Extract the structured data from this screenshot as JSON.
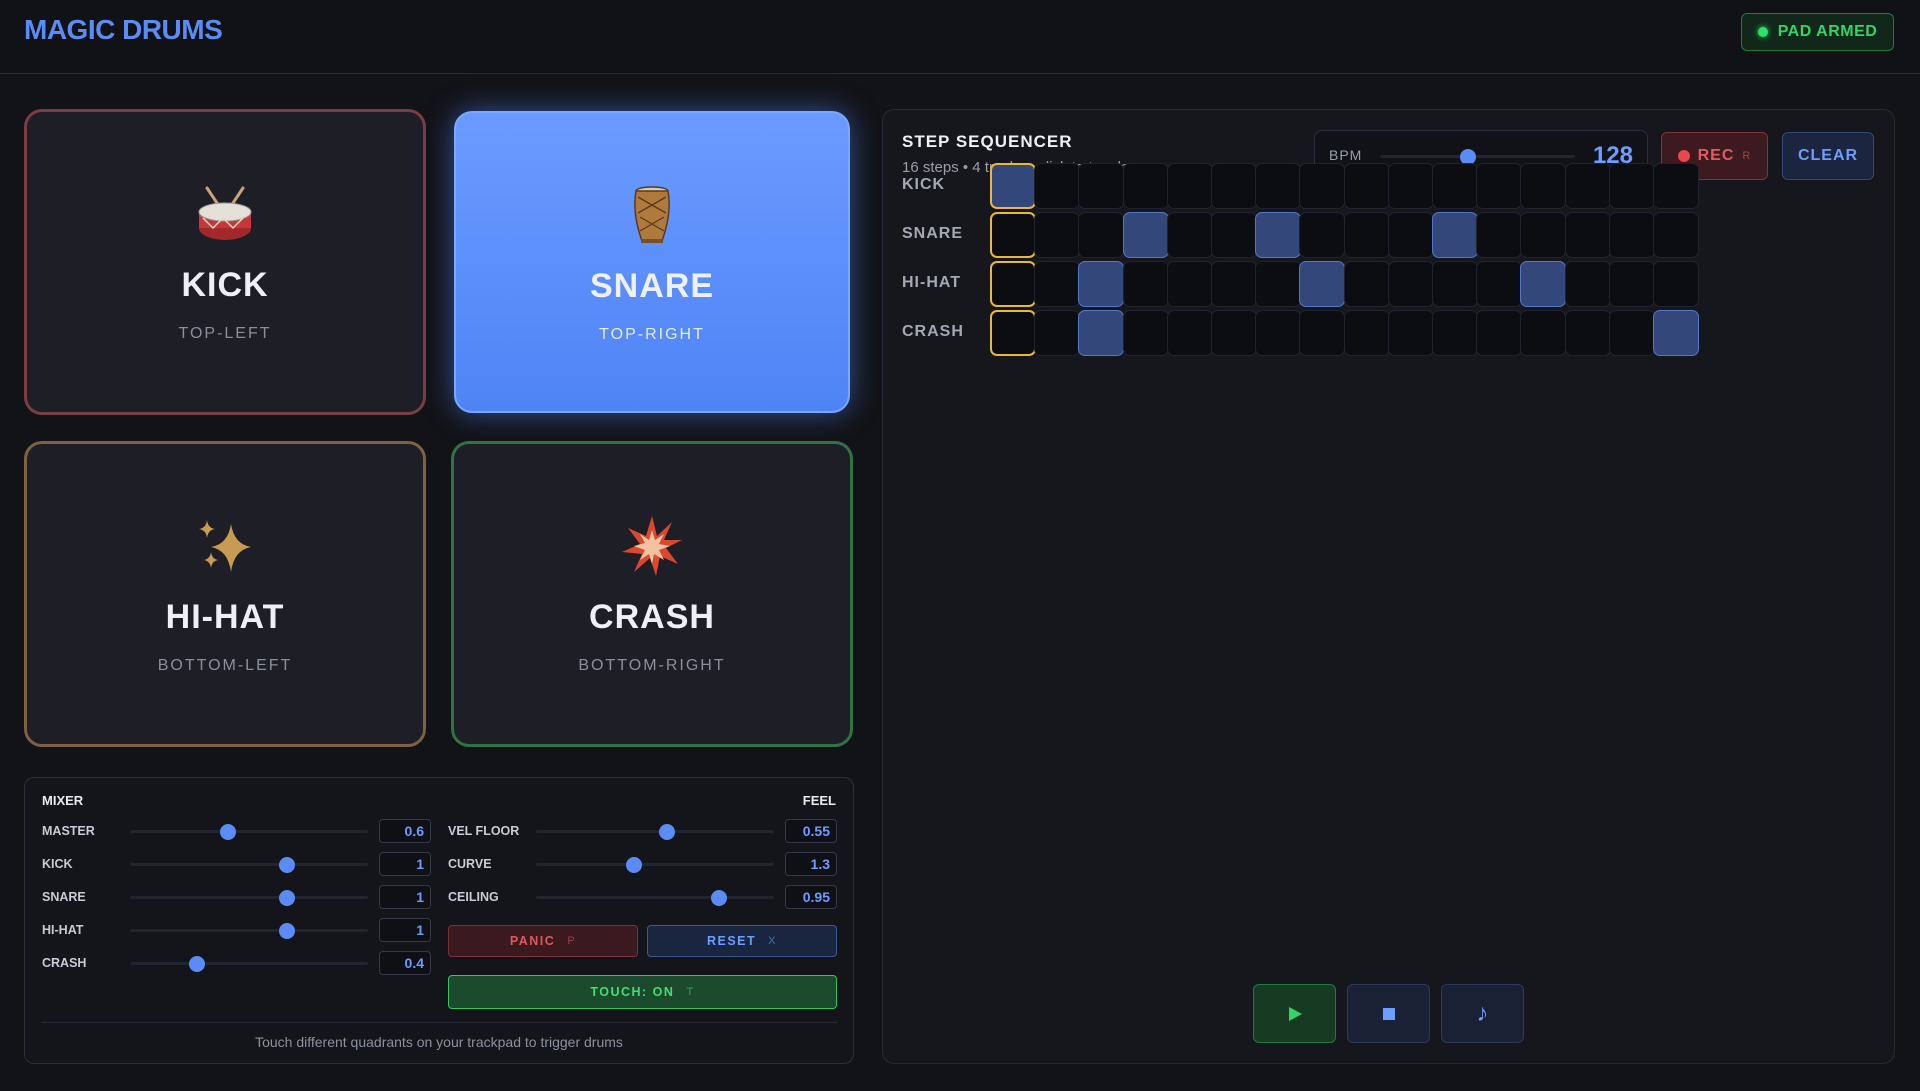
{
  "app": {
    "title": "MAGIC DRUMS",
    "status": "PAD ARMED",
    "status_color": "#2ee06a"
  },
  "pads": [
    {
      "name": "KICK",
      "position": "TOP-LEFT",
      "icon": "drum-icon"
    },
    {
      "name": "SNARE",
      "position": "TOP-RIGHT",
      "icon": "long-drum-icon",
      "active": true
    },
    {
      "name": "HI-HAT",
      "position": "BOTTOM-LEFT",
      "icon": "sparkles-icon"
    },
    {
      "name": "CRASH",
      "position": "BOTTOM-RIGHT",
      "icon": "collision-icon"
    }
  ],
  "mixer": {
    "title": "MIXER",
    "channels": [
      {
        "label": "MASTER",
        "value": "0.6",
        "level": 0.41
      },
      {
        "label": "KICK",
        "value": "1",
        "level": 0.66
      },
      {
        "label": "SNARE",
        "value": "1",
        "level": 0.66
      },
      {
        "label": "HI-HAT",
        "value": "1",
        "level": 0.66
      },
      {
        "label": "CRASH",
        "value": "0.4",
        "level": 0.28
      }
    ]
  },
  "feel": {
    "title": "FEEL",
    "controls": [
      {
        "label": "VEL FLOOR",
        "value": "0.55",
        "level": 0.55
      },
      {
        "label": "CURVE",
        "value": "1.3",
        "level": 0.41
      },
      {
        "label": "CEILING",
        "value": "0.95",
        "level": 0.77
      }
    ]
  },
  "buttons": {
    "panic": "PANIC",
    "panic_key": "P",
    "reset": "RESET",
    "reset_key": "X",
    "touch": "TOUCH: ON",
    "touch_key": "T"
  },
  "hint": "Touch different quadrants on your trackpad to trigger drums",
  "sequencer": {
    "title": "STEP SEQUENCER",
    "subtitle": "16 steps • 4 tracks • click to toggle",
    "bpm_label": "BPM",
    "bpm": "128",
    "bpm_level": 0.45,
    "rec_label": "REC",
    "rec_key": "R",
    "clear_label": "CLEAR",
    "current_step": 0,
    "tracks": [
      {
        "name": "KICK",
        "steps": [
          1,
          0,
          0,
          0,
          0,
          0,
          0,
          0,
          0,
          0,
          0,
          0,
          0,
          0,
          0,
          0
        ]
      },
      {
        "name": "SNARE",
        "steps": [
          0,
          0,
          0,
          1,
          0,
          0,
          1,
          0,
          0,
          0,
          1,
          0,
          0,
          0,
          0,
          0
        ]
      },
      {
        "name": "HI-HAT",
        "steps": [
          0,
          0,
          1,
          0,
          0,
          0,
          0,
          1,
          0,
          0,
          0,
          0,
          1,
          0,
          0,
          0
        ]
      },
      {
        "name": "CRASH",
        "steps": [
          0,
          0,
          1,
          0,
          0,
          0,
          0,
          0,
          0,
          0,
          0,
          0,
          0,
          0,
          0,
          1
        ]
      }
    ],
    "transport": {
      "play": "play-icon",
      "stop": "stop-icon",
      "metronome": "music-note-icon",
      "metronome_glyph": "♪"
    }
  }
}
